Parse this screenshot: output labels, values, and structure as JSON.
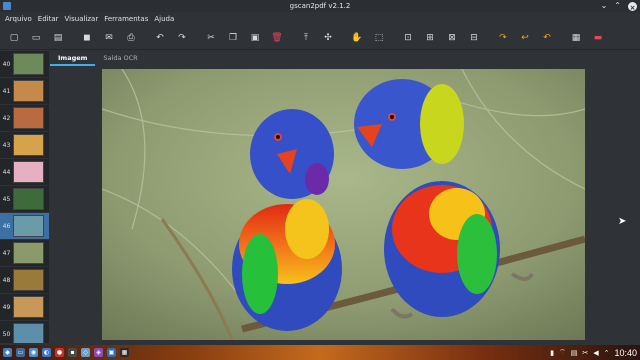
{
  "window": {
    "title": "gscan2pdf v2.1.2"
  },
  "menu": [
    "Arquivo",
    "Editar",
    "Visualizar",
    "Ferramentas",
    "Ajuda"
  ],
  "tabs": {
    "image": "Imagem",
    "ocr": "Saída OCR"
  },
  "thumbnails": [
    {
      "num": "40"
    },
    {
      "num": "41"
    },
    {
      "num": "42"
    },
    {
      "num": "43"
    },
    {
      "num": "44"
    },
    {
      "num": "45"
    },
    {
      "num": "46"
    },
    {
      "num": "47"
    },
    {
      "num": "48"
    },
    {
      "num": "49"
    },
    {
      "num": "50"
    }
  ],
  "selected_thumbnail": "46",
  "tray": {
    "clock": "10:40"
  },
  "colors": {
    "accent": "#3daee9",
    "selection": "#3d6fa5"
  }
}
